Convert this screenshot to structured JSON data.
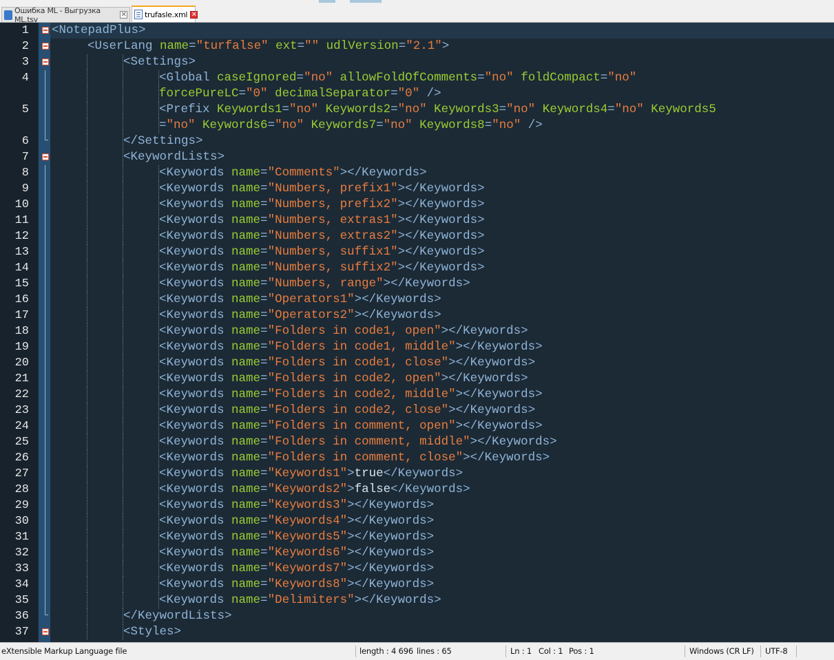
{
  "tabs": [
    {
      "label": "Ошибка ML - Выгрузка ML.tsv",
      "active": false
    },
    {
      "label": "trufasle.xml",
      "active": true
    }
  ],
  "editor": {
    "lines": [
      {
        "n": "1",
        "ind": 0,
        "fold": "open",
        "tok": [
          [
            "t",
            "<NotepadPlus>"
          ]
        ]
      },
      {
        "n": "2",
        "ind": 1,
        "fold": "open",
        "tok": [
          [
            "t",
            "<UserLang "
          ],
          [
            "a",
            "name"
          ],
          [
            "t",
            "="
          ],
          [
            "v",
            "\"turfalse\""
          ],
          [
            "t",
            " "
          ],
          [
            "a",
            "ext"
          ],
          [
            "t",
            "="
          ],
          [
            "v",
            "\"\""
          ],
          [
            "t",
            " "
          ],
          [
            "a",
            "udlVersion"
          ],
          [
            "t",
            "="
          ],
          [
            "v",
            "\"2.1\""
          ],
          [
            "t",
            ">"
          ]
        ]
      },
      {
        "n": "3",
        "ind": 2,
        "fold": "open",
        "tok": [
          [
            "t",
            "<Settings>"
          ]
        ]
      },
      {
        "n": "4",
        "ind": 3,
        "fold": "line",
        "tok": [
          [
            "t",
            "<Global "
          ],
          [
            "a",
            "caseIgnored"
          ],
          [
            "t",
            "="
          ],
          [
            "v",
            "\"no\""
          ],
          [
            "t",
            " "
          ],
          [
            "a",
            "allowFoldOfComments"
          ],
          [
            "t",
            "="
          ],
          [
            "v",
            "\"no\""
          ],
          [
            "t",
            " "
          ],
          [
            "a",
            "foldCompact"
          ],
          [
            "t",
            "="
          ],
          [
            "v",
            "\"no\""
          ]
        ]
      },
      {
        "n": "",
        "ind": 3,
        "fold": "line",
        "tok": [
          [
            "a",
            "forcePureLC"
          ],
          [
            "t",
            "="
          ],
          [
            "v",
            "\"0\""
          ],
          [
            "t",
            " "
          ],
          [
            "a",
            "decimalSeparator"
          ],
          [
            "t",
            "="
          ],
          [
            "v",
            "\"0\""
          ],
          [
            "t",
            " />"
          ]
        ]
      },
      {
        "n": "5",
        "ind": 3,
        "fold": "line",
        "tok": [
          [
            "t",
            "<Prefix "
          ],
          [
            "a",
            "Keywords1"
          ],
          [
            "t",
            "="
          ],
          [
            "v",
            "\"no\""
          ],
          [
            "t",
            " "
          ],
          [
            "a",
            "Keywords2"
          ],
          [
            "t",
            "="
          ],
          [
            "v",
            "\"no\""
          ],
          [
            "t",
            " "
          ],
          [
            "a",
            "Keywords3"
          ],
          [
            "t",
            "="
          ],
          [
            "v",
            "\"no\""
          ],
          [
            "t",
            " "
          ],
          [
            "a",
            "Keywords4"
          ],
          [
            "t",
            "="
          ],
          [
            "v",
            "\"no\""
          ],
          [
            "t",
            " "
          ],
          [
            "a",
            "Keywords5"
          ]
        ]
      },
      {
        "n": "",
        "ind": 3,
        "fold": "line",
        "tok": [
          [
            "t",
            "="
          ],
          [
            "v",
            "\"no\""
          ],
          [
            "t",
            " "
          ],
          [
            "a",
            "Keywords6"
          ],
          [
            "t",
            "="
          ],
          [
            "v",
            "\"no\""
          ],
          [
            "t",
            " "
          ],
          [
            "a",
            "Keywords7"
          ],
          [
            "t",
            "="
          ],
          [
            "v",
            "\"no\""
          ],
          [
            "t",
            " "
          ],
          [
            "a",
            "Keywords8"
          ],
          [
            "t",
            "="
          ],
          [
            "v",
            "\"no\""
          ],
          [
            "t",
            " />"
          ]
        ]
      },
      {
        "n": "6",
        "ind": 2,
        "fold": "end",
        "tok": [
          [
            "t",
            "</Settings>"
          ]
        ]
      },
      {
        "n": "7",
        "ind": 2,
        "fold": "open",
        "tok": [
          [
            "t",
            "<KeywordLists>"
          ]
        ]
      },
      {
        "n": "8",
        "ind": 3,
        "fold": "line",
        "tok": [
          [
            "t",
            "<Keywords "
          ],
          [
            "a",
            "name"
          ],
          [
            "t",
            "="
          ],
          [
            "v",
            "\"Comments\""
          ],
          [
            "t",
            "></Keywords>"
          ]
        ]
      },
      {
        "n": "9",
        "ind": 3,
        "fold": "line",
        "tok": [
          [
            "t",
            "<Keywords "
          ],
          [
            "a",
            "name"
          ],
          [
            "t",
            "="
          ],
          [
            "v",
            "\"Numbers, prefix1\""
          ],
          [
            "t",
            "></Keywords>"
          ]
        ]
      },
      {
        "n": "10",
        "ind": 3,
        "fold": "line",
        "tok": [
          [
            "t",
            "<Keywords "
          ],
          [
            "a",
            "name"
          ],
          [
            "t",
            "="
          ],
          [
            "v",
            "\"Numbers, prefix2\""
          ],
          [
            "t",
            "></Keywords>"
          ]
        ]
      },
      {
        "n": "11",
        "ind": 3,
        "fold": "line",
        "tok": [
          [
            "t",
            "<Keywords "
          ],
          [
            "a",
            "name"
          ],
          [
            "t",
            "="
          ],
          [
            "v",
            "\"Numbers, extras1\""
          ],
          [
            "t",
            "></Keywords>"
          ]
        ]
      },
      {
        "n": "12",
        "ind": 3,
        "fold": "line",
        "tok": [
          [
            "t",
            "<Keywords "
          ],
          [
            "a",
            "name"
          ],
          [
            "t",
            "="
          ],
          [
            "v",
            "\"Numbers, extras2\""
          ],
          [
            "t",
            "></Keywords>"
          ]
        ]
      },
      {
        "n": "13",
        "ind": 3,
        "fold": "line",
        "tok": [
          [
            "t",
            "<Keywords "
          ],
          [
            "a",
            "name"
          ],
          [
            "t",
            "="
          ],
          [
            "v",
            "\"Numbers, suffix1\""
          ],
          [
            "t",
            "></Keywords>"
          ]
        ]
      },
      {
        "n": "14",
        "ind": 3,
        "fold": "line",
        "tok": [
          [
            "t",
            "<Keywords "
          ],
          [
            "a",
            "name"
          ],
          [
            "t",
            "="
          ],
          [
            "v",
            "\"Numbers, suffix2\""
          ],
          [
            "t",
            "></Keywords>"
          ]
        ]
      },
      {
        "n": "15",
        "ind": 3,
        "fold": "line",
        "tok": [
          [
            "t",
            "<Keywords "
          ],
          [
            "a",
            "name"
          ],
          [
            "t",
            "="
          ],
          [
            "v",
            "\"Numbers, range\""
          ],
          [
            "t",
            "></Keywords>"
          ]
        ]
      },
      {
        "n": "16",
        "ind": 3,
        "fold": "line",
        "tok": [
          [
            "t",
            "<Keywords "
          ],
          [
            "a",
            "name"
          ],
          [
            "t",
            "="
          ],
          [
            "v",
            "\"Operators1\""
          ],
          [
            "t",
            "></Keywords>"
          ]
        ]
      },
      {
        "n": "17",
        "ind": 3,
        "fold": "line",
        "tok": [
          [
            "t",
            "<Keywords "
          ],
          [
            "a",
            "name"
          ],
          [
            "t",
            "="
          ],
          [
            "v",
            "\"Operators2\""
          ],
          [
            "t",
            "></Keywords>"
          ]
        ]
      },
      {
        "n": "18",
        "ind": 3,
        "fold": "line",
        "tok": [
          [
            "t",
            "<Keywords "
          ],
          [
            "a",
            "name"
          ],
          [
            "t",
            "="
          ],
          [
            "v",
            "\"Folders in code1, open\""
          ],
          [
            "t",
            "></Keywords>"
          ]
        ]
      },
      {
        "n": "19",
        "ind": 3,
        "fold": "line",
        "tok": [
          [
            "t",
            "<Keywords "
          ],
          [
            "a",
            "name"
          ],
          [
            "t",
            "="
          ],
          [
            "v",
            "\"Folders in code1, middle\""
          ],
          [
            "t",
            "></Keywords>"
          ]
        ]
      },
      {
        "n": "20",
        "ind": 3,
        "fold": "line",
        "tok": [
          [
            "t",
            "<Keywords "
          ],
          [
            "a",
            "name"
          ],
          [
            "t",
            "="
          ],
          [
            "v",
            "\"Folders in code1, close\""
          ],
          [
            "t",
            "></Keywords>"
          ]
        ]
      },
      {
        "n": "21",
        "ind": 3,
        "fold": "line",
        "tok": [
          [
            "t",
            "<Keywords "
          ],
          [
            "a",
            "name"
          ],
          [
            "t",
            "="
          ],
          [
            "v",
            "\"Folders in code2, open\""
          ],
          [
            "t",
            "></Keywords>"
          ]
        ]
      },
      {
        "n": "22",
        "ind": 3,
        "fold": "line",
        "tok": [
          [
            "t",
            "<Keywords "
          ],
          [
            "a",
            "name"
          ],
          [
            "t",
            "="
          ],
          [
            "v",
            "\"Folders in code2, middle\""
          ],
          [
            "t",
            "></Keywords>"
          ]
        ]
      },
      {
        "n": "23",
        "ind": 3,
        "fold": "line",
        "tok": [
          [
            "t",
            "<Keywords "
          ],
          [
            "a",
            "name"
          ],
          [
            "t",
            "="
          ],
          [
            "v",
            "\"Folders in code2, close\""
          ],
          [
            "t",
            "></Keywords>"
          ]
        ]
      },
      {
        "n": "24",
        "ind": 3,
        "fold": "line",
        "tok": [
          [
            "t",
            "<Keywords "
          ],
          [
            "a",
            "name"
          ],
          [
            "t",
            "="
          ],
          [
            "v",
            "\"Folders in comment, open\""
          ],
          [
            "t",
            "></Keywords>"
          ]
        ]
      },
      {
        "n": "25",
        "ind": 3,
        "fold": "line",
        "tok": [
          [
            "t",
            "<Keywords "
          ],
          [
            "a",
            "name"
          ],
          [
            "t",
            "="
          ],
          [
            "v",
            "\"Folders in comment, middle\""
          ],
          [
            "t",
            "></Keywords>"
          ]
        ]
      },
      {
        "n": "26",
        "ind": 3,
        "fold": "line",
        "tok": [
          [
            "t",
            "<Keywords "
          ],
          [
            "a",
            "name"
          ],
          [
            "t",
            "="
          ],
          [
            "v",
            "\"Folders in comment, close\""
          ],
          [
            "t",
            "></Keywords>"
          ]
        ]
      },
      {
        "n": "27",
        "ind": 3,
        "fold": "line",
        "tok": [
          [
            "t",
            "<Keywords "
          ],
          [
            "a",
            "name"
          ],
          [
            "t",
            "="
          ],
          [
            "v",
            "\"Keywords1\""
          ],
          [
            "t",
            ">"
          ],
          [
            "x",
            "true"
          ],
          [
            "t",
            "</Keywords>"
          ]
        ]
      },
      {
        "n": "28",
        "ind": 3,
        "fold": "line",
        "tok": [
          [
            "t",
            "<Keywords "
          ],
          [
            "a",
            "name"
          ],
          [
            "t",
            "="
          ],
          [
            "v",
            "\"Keywords2\""
          ],
          [
            "t",
            ">"
          ],
          [
            "x",
            "false"
          ],
          [
            "t",
            "</Keywords>"
          ]
        ]
      },
      {
        "n": "29",
        "ind": 3,
        "fold": "line",
        "tok": [
          [
            "t",
            "<Keywords "
          ],
          [
            "a",
            "name"
          ],
          [
            "t",
            "="
          ],
          [
            "v",
            "\"Keywords3\""
          ],
          [
            "t",
            "></Keywords>"
          ]
        ]
      },
      {
        "n": "30",
        "ind": 3,
        "fold": "line",
        "tok": [
          [
            "t",
            "<Keywords "
          ],
          [
            "a",
            "name"
          ],
          [
            "t",
            "="
          ],
          [
            "v",
            "\"Keywords4\""
          ],
          [
            "t",
            "></Keywords>"
          ]
        ]
      },
      {
        "n": "31",
        "ind": 3,
        "fold": "line",
        "tok": [
          [
            "t",
            "<Keywords "
          ],
          [
            "a",
            "name"
          ],
          [
            "t",
            "="
          ],
          [
            "v",
            "\"Keywords5\""
          ],
          [
            "t",
            "></Keywords>"
          ]
        ]
      },
      {
        "n": "32",
        "ind": 3,
        "fold": "line",
        "tok": [
          [
            "t",
            "<Keywords "
          ],
          [
            "a",
            "name"
          ],
          [
            "t",
            "="
          ],
          [
            "v",
            "\"Keywords6\""
          ],
          [
            "t",
            "></Keywords>"
          ]
        ]
      },
      {
        "n": "33",
        "ind": 3,
        "fold": "line",
        "tok": [
          [
            "t",
            "<Keywords "
          ],
          [
            "a",
            "name"
          ],
          [
            "t",
            "="
          ],
          [
            "v",
            "\"Keywords7\""
          ],
          [
            "t",
            "></Keywords>"
          ]
        ]
      },
      {
        "n": "34",
        "ind": 3,
        "fold": "line",
        "tok": [
          [
            "t",
            "<Keywords "
          ],
          [
            "a",
            "name"
          ],
          [
            "t",
            "="
          ],
          [
            "v",
            "\"Keywords8\""
          ],
          [
            "t",
            "></Keywords>"
          ]
        ]
      },
      {
        "n": "35",
        "ind": 3,
        "fold": "line",
        "tok": [
          [
            "t",
            "<Keywords "
          ],
          [
            "a",
            "name"
          ],
          [
            "t",
            "="
          ],
          [
            "v",
            "\"Delimiters\""
          ],
          [
            "t",
            "></Keywords>"
          ]
        ]
      },
      {
        "n": "36",
        "ind": 2,
        "fold": "end",
        "tok": [
          [
            "t",
            "</KeywordLists>"
          ]
        ]
      },
      {
        "n": "37",
        "ind": 2,
        "fold": "open",
        "tok": [
          [
            "t",
            "<Styles>"
          ]
        ]
      }
    ]
  },
  "statusbar": {
    "file_type": "eXtensible Markup Language file",
    "length": "length : 4 696",
    "lines": "lines : 65",
    "ln": "Ln : 1",
    "col": "Col : 1",
    "pos": "Pos : 1",
    "eol": "Windows (CR LF)",
    "encoding": "UTF-8"
  },
  "colors": {
    "editor_bg": "#1c2a36",
    "tag": "#8fb4d6",
    "attribute": "#9acd32",
    "value": "#e87d3e",
    "text": "#d6e4ef",
    "fold_margin": "#274f73",
    "active_tab_accent": "#f5a623"
  }
}
